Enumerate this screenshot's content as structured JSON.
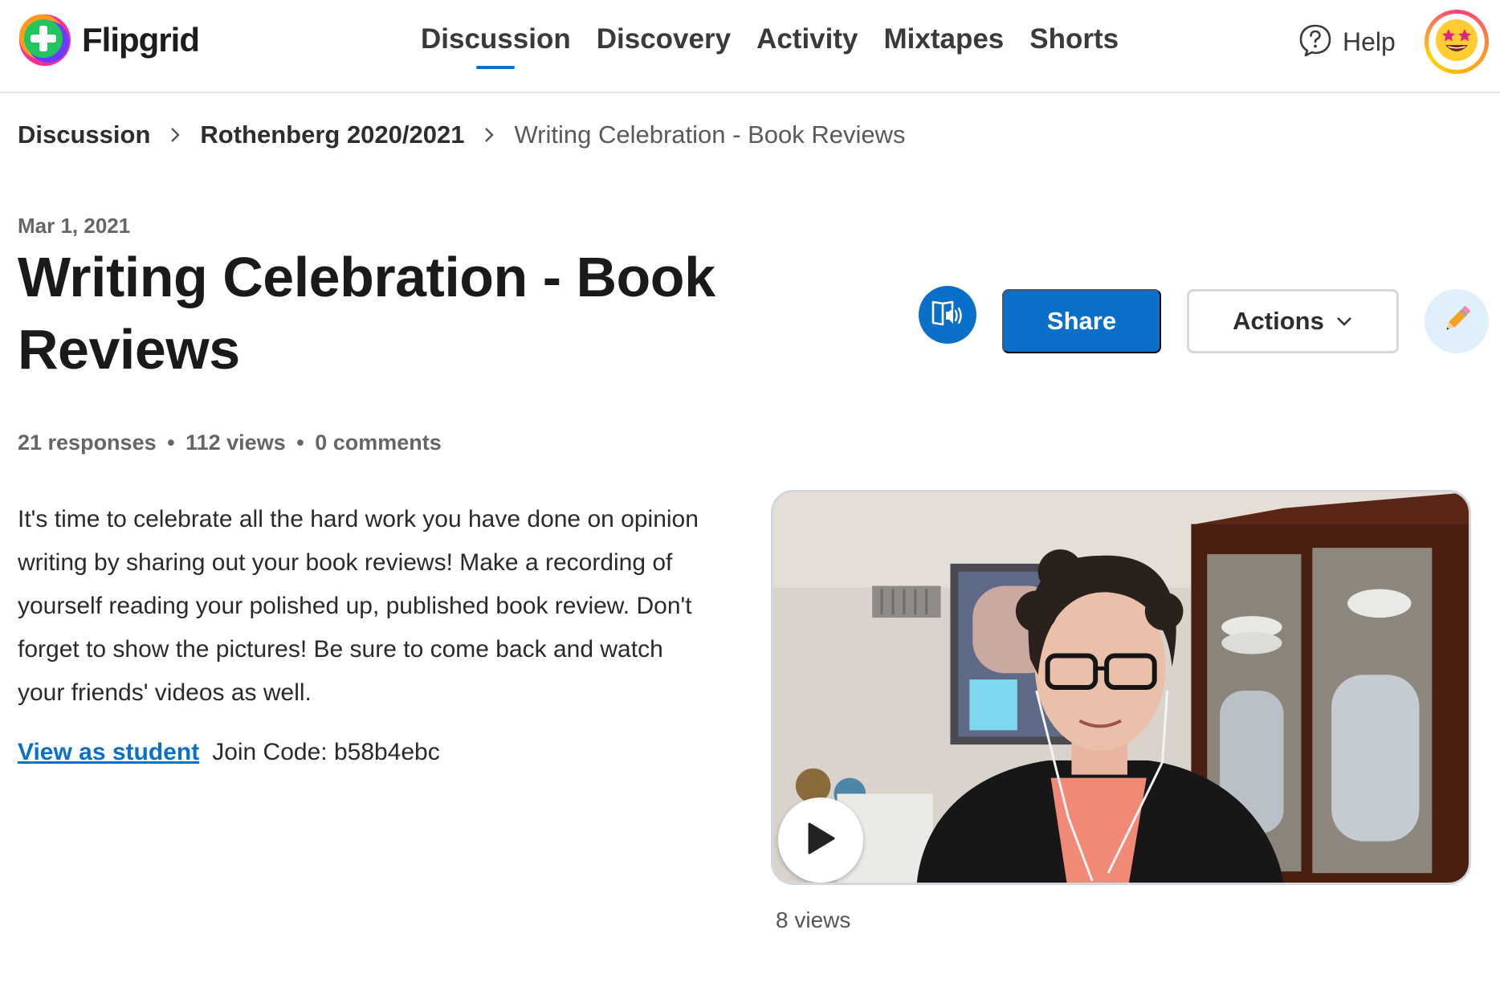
{
  "app": {
    "name": "Flipgrid"
  },
  "nav": {
    "items": [
      {
        "label": "Discussion",
        "active": true
      },
      {
        "label": "Discovery",
        "active": false
      },
      {
        "label": "Activity",
        "active": false
      },
      {
        "label": "Mixtapes",
        "active": false
      },
      {
        "label": "Shorts",
        "active": false
      }
    ],
    "help_label": "Help",
    "help_icon": "question-bubble-icon",
    "avatar_icon": "star-struck-emoji"
  },
  "breadcrumb": {
    "items": [
      "Discussion",
      "Rothenberg 2020/2021",
      "Writing Celebration - Book Reviews"
    ]
  },
  "topic": {
    "date": "Mar 1, 2021",
    "title": "Writing Celebration - Book Reviews",
    "stats": {
      "responses": "21 responses",
      "views": "112 views",
      "comments": "0 comments",
      "separator": "•"
    },
    "description": "It's time to celebrate all the hard work you have done on opinion writing by sharing out your book reviews! Make a recording of yourself reading your polished up, published book review. Don't forget to show the pictures! Be sure to come back and watch your friends' videos as well.",
    "view_as_student": "View as student",
    "join_code": "Join Code: b58b4ebc"
  },
  "toolbar": {
    "immersive_reader_icon": "immersive-reader-icon",
    "share_label": "Share",
    "actions_label": "Actions",
    "edit_icon": "pencil-icon"
  },
  "video": {
    "views": "8 views",
    "play_icon": "play-icon"
  },
  "colors": {
    "accent": "#0a6fc9",
    "edit_bg": "#dff0fb",
    "muted_text": "#666666",
    "divider": "#e3e3e3"
  }
}
